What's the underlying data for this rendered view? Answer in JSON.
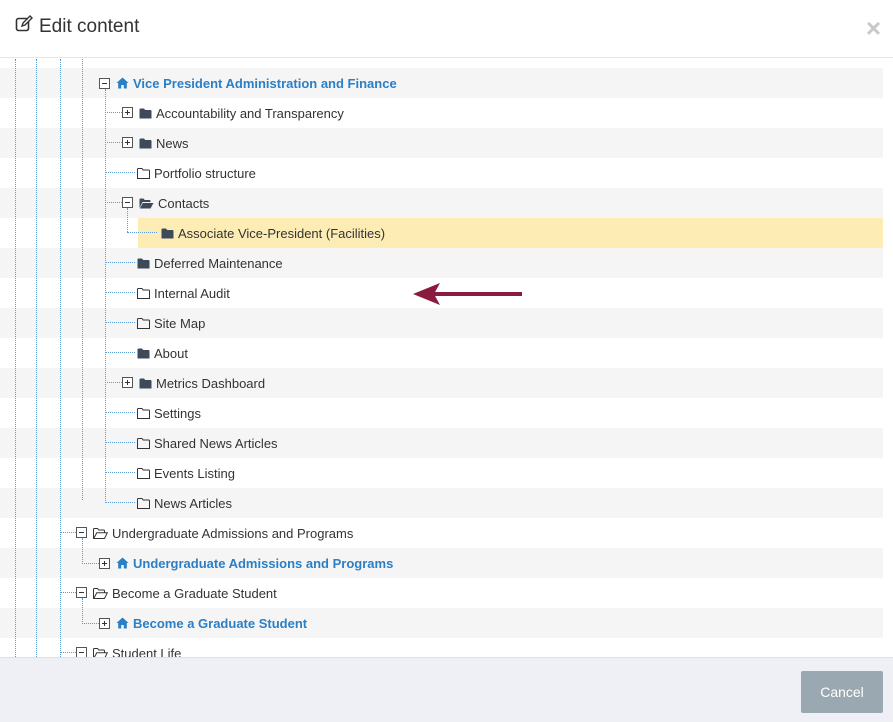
{
  "header": {
    "title": "Edit content",
    "close_label": "×"
  },
  "footer": {
    "cancel_label": "Cancel"
  },
  "tree": {
    "vp_admin": "Vice President Administration and Finance",
    "accountability": "Accountability and Transparency",
    "news": "News",
    "portfolio": "Portfolio structure",
    "contacts": "Contacts",
    "assoc_vp": "Associate Vice-President (Facilities)",
    "deferred": "Deferred Maintenance",
    "internal_audit": "Internal Audit",
    "site_map": "Site Map",
    "about": "About",
    "metrics": "Metrics Dashboard",
    "settings": "Settings",
    "shared_news": "Shared News Articles",
    "events": "Events Listing",
    "news_articles": "News Articles",
    "ug_admissions_folder": "Undergraduate Admissions and Programs",
    "ug_admissions_home": "Undergraduate Admissions and Programs",
    "grad_folder": "Become a Graduate Student",
    "grad_home": "Become a Graduate Student",
    "student_life": "Student Life"
  },
  "colors": {
    "link": "#2a7fc6",
    "highlight": "#fdedb5",
    "arrow": "#8a1a3e"
  }
}
